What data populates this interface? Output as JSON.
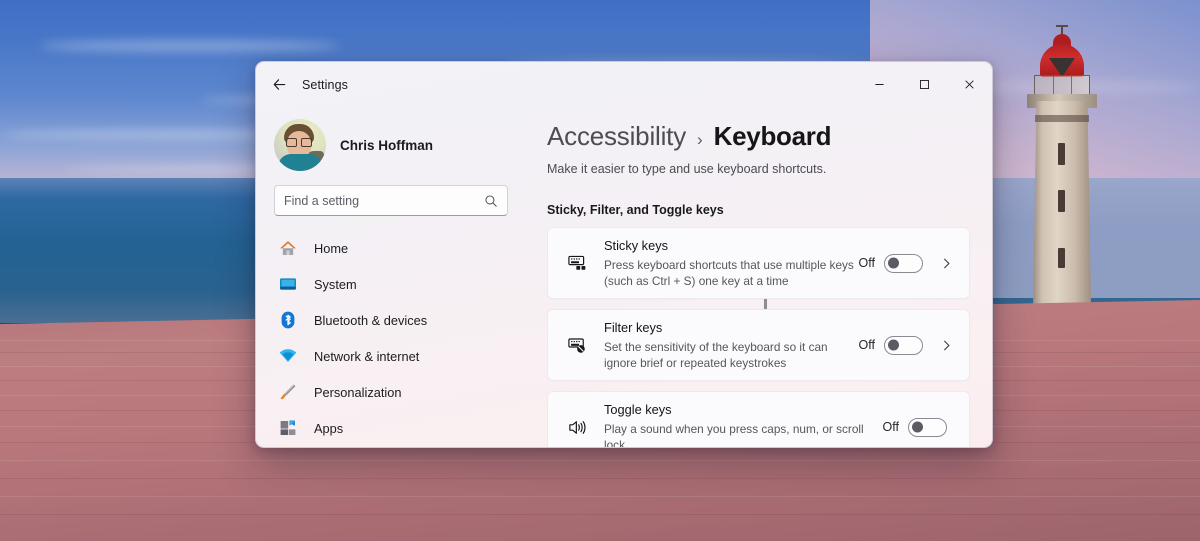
{
  "window": {
    "app_title": "Settings",
    "back_icon": "back-arrow-icon",
    "controls": {
      "minimize_label": "Minimize",
      "maximize_label": "Maximize",
      "close_label": "Close"
    }
  },
  "sidebar": {
    "profile": {
      "name": "Chris Hoffman",
      "avatar_alt": "user-avatar"
    },
    "search": {
      "placeholder": "Find a setting",
      "value": "",
      "icon": "search-icon"
    },
    "items": [
      {
        "label": "Home",
        "icon": "home-icon"
      },
      {
        "label": "System",
        "icon": "system-monitor-icon"
      },
      {
        "label": "Bluetooth & devices",
        "icon": "bluetooth-icon"
      },
      {
        "label": "Network & internet",
        "icon": "wifi-icon"
      },
      {
        "label": "Personalization",
        "icon": "paintbrush-icon"
      },
      {
        "label": "Apps",
        "icon": "apps-icon"
      }
    ]
  },
  "main": {
    "breadcrumb": {
      "parent": "Accessibility",
      "separator": "›",
      "current": "Keyboard"
    },
    "description": "Make it easier to type and use keyboard shortcuts.",
    "section_title": "Sticky, Filter, and Toggle keys",
    "cards": [
      {
        "title": "Sticky keys",
        "subtitle": "Press keyboard shortcuts that use multiple keys (such as Ctrl + S) one key at a time",
        "state": "Off",
        "toggle_on": false,
        "icon": "sticky-keys-keyboard-icon",
        "has_chevron": true,
        "chevron": "›"
      },
      {
        "title": "Filter keys",
        "subtitle": "Set the sensitivity of the keyboard so it can ignore brief or repeated keystrokes",
        "state": "Off",
        "toggle_on": false,
        "icon": "filter-keys-keyboard-icon",
        "has_chevron": true,
        "chevron": "›"
      },
      {
        "title": "Toggle keys",
        "subtitle": "Play a sound when you press caps, num, or scroll lock",
        "state": "Off",
        "toggle_on": false,
        "icon": "speaker-sound-icon",
        "has_chevron": false,
        "chevron": ""
      }
    ]
  },
  "colors": {
    "accent_blue": "#0b7ed0",
    "lighthouse_red": "#c02a2a",
    "window_bg_top": "#f2f2f7",
    "window_bg_bottom": "#fbeef0",
    "card_bg": "#fbfafc"
  }
}
